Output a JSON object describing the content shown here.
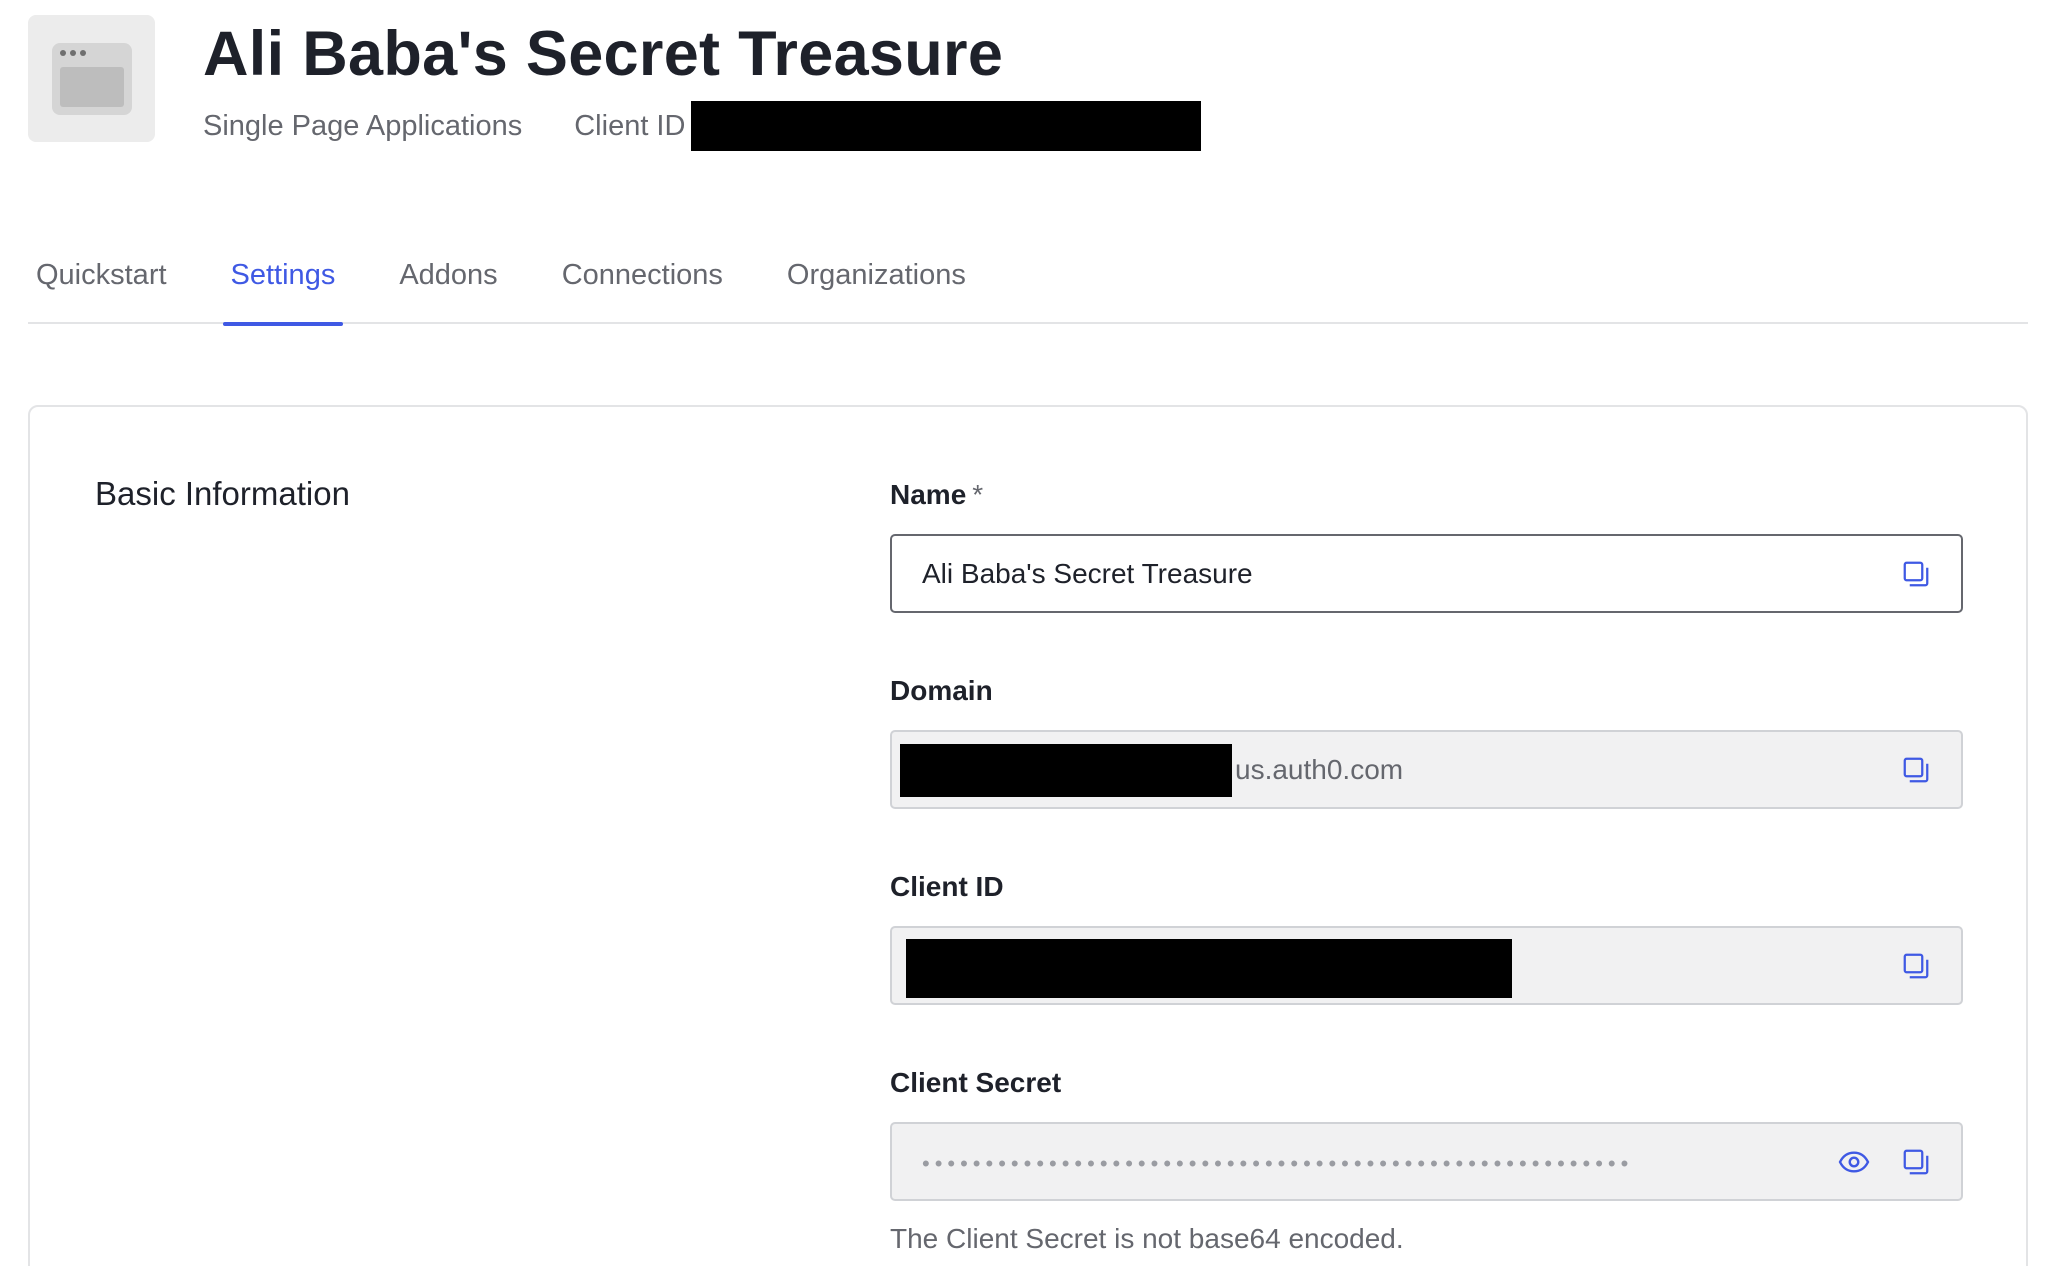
{
  "header": {
    "title": "Ali Baba's Secret Treasure",
    "app_type": "Single Page Applications",
    "client_id_label": "Client ID",
    "icon": "browser-window-icon"
  },
  "tabs": [
    {
      "label": "Quickstart",
      "active": false
    },
    {
      "label": "Settings",
      "active": true
    },
    {
      "label": "Addons",
      "active": false
    },
    {
      "label": "Connections",
      "active": false
    },
    {
      "label": "Organizations",
      "active": false
    }
  ],
  "basic_info": {
    "section_title": "Basic Information",
    "name": {
      "label": "Name",
      "required_mark": "*",
      "value": "Ali Baba's Secret Treasure"
    },
    "domain": {
      "label": "Domain",
      "visible_suffix": "us.auth0.com"
    },
    "client_id": {
      "label": "Client ID"
    },
    "client_secret": {
      "label": "Client Secret",
      "masked_value": "••••••••••••••••••••••••••••••••••••••••••••••••••••••••",
      "helper": "The Client Secret is not base64 encoded."
    }
  },
  "icons": {
    "copy": "copy-icon",
    "reveal": "eye-icon"
  },
  "colors": {
    "accent": "#3f59e4",
    "text": "#1e212a",
    "muted": "#65676e",
    "field_bg": "#f1f1f2",
    "border": "#e3e4e6"
  }
}
